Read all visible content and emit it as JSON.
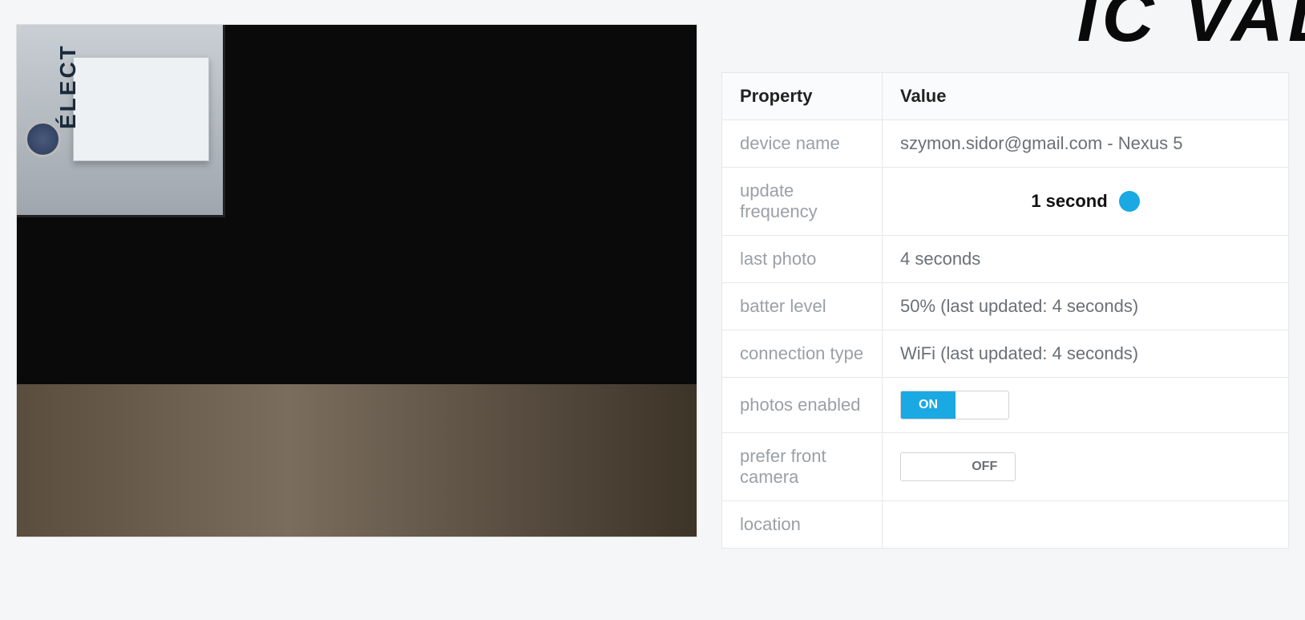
{
  "header": {
    "title_fragment": "IC VAL"
  },
  "photo_panel": {
    "side_text": "ÉLECT"
  },
  "table": {
    "header_property": "Property",
    "header_value": "Value",
    "rows": [
      {
        "key": "device name",
        "value": "szymon.sidor@gmail.com - Nexus 5",
        "type": "text"
      },
      {
        "key": "update frequency",
        "value": "1 second",
        "type": "slider"
      },
      {
        "key": "last photo",
        "value": "4 seconds",
        "type": "text"
      },
      {
        "key": "batter level",
        "value": "50% (last updated: 4 seconds)",
        "type": "text"
      },
      {
        "key": "connection type",
        "value": "WiFi (last updated: 4 seconds)",
        "type": "text"
      },
      {
        "key": "photos enabled",
        "value": "ON",
        "type": "toggle",
        "state": "on"
      },
      {
        "key": "prefer front camera",
        "value": "OFF",
        "type": "toggle",
        "state": "off"
      },
      {
        "key": "location",
        "value": "",
        "type": "text"
      }
    ]
  }
}
